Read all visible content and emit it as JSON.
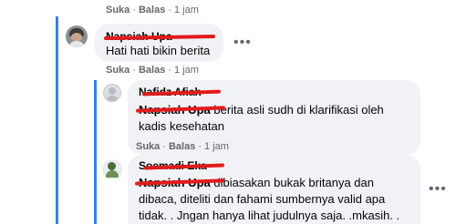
{
  "top_actions": {
    "like": "Suka",
    "reply": "Balas",
    "time": "1 jam"
  },
  "comments": [
    {
      "author": "Napsiah Upa",
      "text": "Hati hati bikin berita",
      "actions": {
        "like": "Suka",
        "reply": "Balas",
        "time": "1 jam"
      }
    },
    {
      "author": "Nafidz Afiah",
      "tagged": "Napsiah Upa",
      "text": " berita asli sudh di klarifikasi oleh kadis kesehatan",
      "actions": {
        "like": "Suka",
        "reply": "Balas",
        "time": "1 jam"
      }
    },
    {
      "author": "Soemadi Eka",
      "tagged": "Napsiah Upa",
      "text": " dibiasakan bukak britanya dan dibaca, diteliti dan fahami sumbernya valid apa tidak. . Jngan hanya lihat judulnya saja. .mkasih. ."
    }
  ],
  "colors": {
    "thread_line": "#3b7cf0",
    "bubble": "#f0f2f5",
    "redaction": "#e21b1b",
    "meta": "#65676b"
  },
  "icons": {
    "more": "more-horizontal-icon"
  }
}
